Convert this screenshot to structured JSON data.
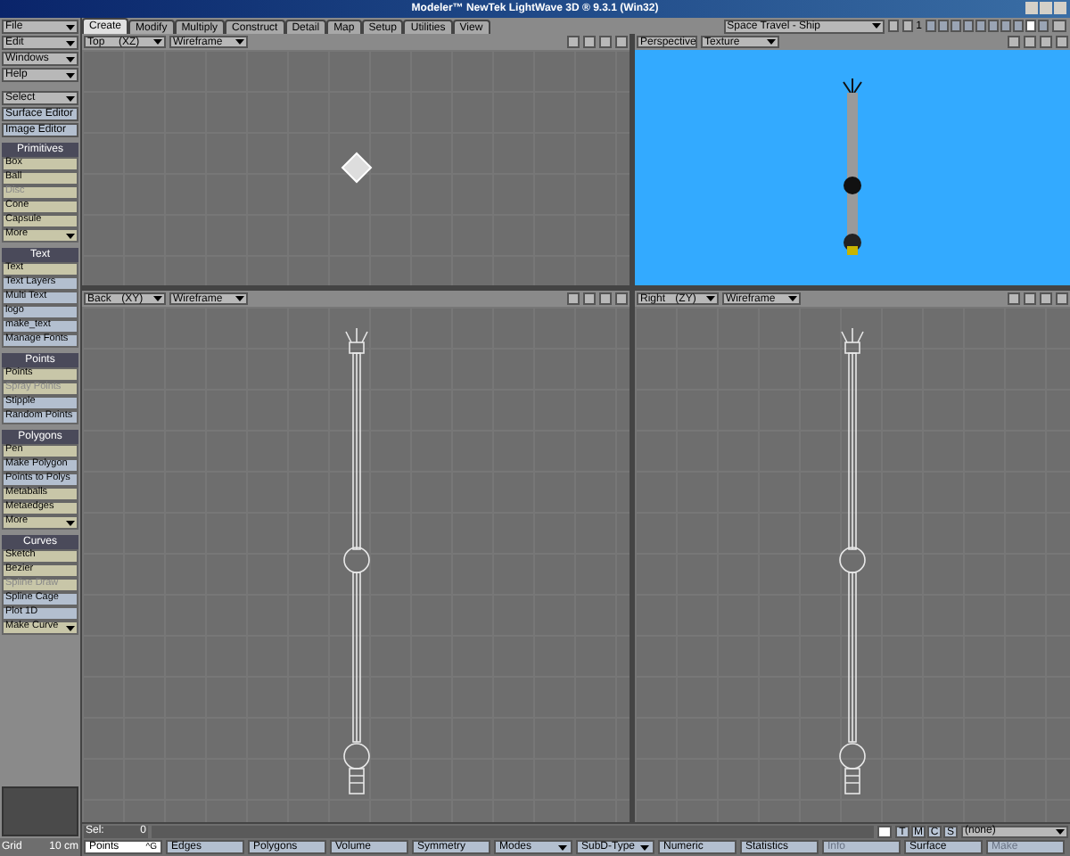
{
  "window": {
    "title": "Modeler™ NewTek LightWave 3D ® 9.3.1 (Win32)"
  },
  "menus": [
    {
      "label": "File",
      "kind": "dropdown"
    },
    {
      "label": "Edit",
      "kind": "dropdown"
    },
    {
      "label": "Windows",
      "kind": "dropdown"
    },
    {
      "label": "Help",
      "kind": "dropdown"
    },
    {
      "label": "Select",
      "kind": "dropdown"
    },
    {
      "label": "Surface Editor",
      "kind": "button"
    },
    {
      "label": "Image Editor",
      "kind": "button"
    }
  ],
  "tabs": [
    {
      "label": "Create",
      "selected": true
    },
    {
      "label": "Modify",
      "selected": false
    },
    {
      "label": "Multiply",
      "selected": false
    },
    {
      "label": "Construct",
      "selected": false
    },
    {
      "label": "Detail",
      "selected": false
    },
    {
      "label": "Map",
      "selected": false
    },
    {
      "label": "Setup",
      "selected": false
    },
    {
      "label": "Utilities",
      "selected": false
    },
    {
      "label": "View",
      "selected": false
    }
  ],
  "object": {
    "name": "Space Travel - Ship",
    "layer_number": "1"
  },
  "layers": [
    {
      "selected": false
    },
    {
      "selected": false
    },
    {
      "selected": false
    },
    {
      "selected": false
    },
    {
      "selected": false
    },
    {
      "selected": false
    },
    {
      "selected": false
    },
    {
      "selected": false
    },
    {
      "selected": true
    },
    {
      "selected": false
    }
  ],
  "sections": [
    {
      "title": "Primitives",
      "items": [
        {
          "label": "Box",
          "color": "#c8c6a8",
          "disabled": false,
          "dropdown": false
        },
        {
          "label": "Ball",
          "color": "#c8c6a8",
          "disabled": false,
          "dropdown": false
        },
        {
          "label": "Disc",
          "color": "#c8c6a8",
          "disabled": true,
          "dropdown": false
        },
        {
          "label": "Cone",
          "color": "#c8c6a8",
          "disabled": false,
          "dropdown": false
        },
        {
          "label": "Capsule",
          "color": "#c8c6a8",
          "disabled": false,
          "dropdown": false
        },
        {
          "label": "More",
          "color": "#c8c6a8",
          "disabled": false,
          "dropdown": true
        }
      ]
    },
    {
      "title": "Text",
      "items": [
        {
          "label": "Text",
          "color": "#c8c6a8",
          "disabled": false,
          "dropdown": false
        },
        {
          "label": "Text Layers",
          "color": "#b3bfcf",
          "disabled": false,
          "dropdown": false
        },
        {
          "label": "Multi Text",
          "color": "#b3bfcf",
          "disabled": false,
          "dropdown": false
        },
        {
          "label": "logo",
          "color": "#b3bfcf",
          "disabled": false,
          "dropdown": false
        },
        {
          "label": "make_text",
          "color": "#b3bfcf",
          "disabled": false,
          "dropdown": false
        },
        {
          "label": "Manage Fonts",
          "color": "#b3bfcf",
          "disabled": false,
          "dropdown": false
        }
      ]
    },
    {
      "title": "Points",
      "items": [
        {
          "label": "Points",
          "color": "#c8c6a8",
          "disabled": false,
          "dropdown": false
        },
        {
          "label": "Spray Points",
          "color": "#c8c6a8",
          "disabled": true,
          "dropdown": false
        },
        {
          "label": "Stipple",
          "color": "#b3bfcf",
          "disabled": false,
          "dropdown": false
        },
        {
          "label": "Random Points",
          "color": "#b3bfcf",
          "disabled": false,
          "dropdown": false
        }
      ]
    },
    {
      "title": "Polygons",
      "items": [
        {
          "label": "Pen",
          "color": "#c8c6a8",
          "disabled": false,
          "dropdown": false
        },
        {
          "label": "Make Polygon",
          "color": "#b3bfcf",
          "disabled": false,
          "dropdown": false
        },
        {
          "label": "Points to Polys",
          "color": "#b3bfcf",
          "disabled": false,
          "dropdown": false
        },
        {
          "label": "Metaballs",
          "color": "#c8c6a8",
          "disabled": false,
          "dropdown": false
        },
        {
          "label": "Metaedges",
          "color": "#c8c6a8",
          "disabled": false,
          "dropdown": false
        },
        {
          "label": "More",
          "color": "#c8c6a8",
          "disabled": false,
          "dropdown": true
        }
      ]
    },
    {
      "title": "Curves",
      "items": [
        {
          "label": "Sketch",
          "color": "#c8c6a8",
          "disabled": false,
          "dropdown": false
        },
        {
          "label": "Bezier",
          "color": "#c8c6a8",
          "disabled": false,
          "dropdown": false
        },
        {
          "label": "Spline Draw",
          "color": "#c8c6a8",
          "disabled": true,
          "dropdown": false
        },
        {
          "label": "Spline Cage",
          "color": "#b3bfcf",
          "disabled": false,
          "dropdown": false
        },
        {
          "label": "Plot 1D",
          "color": "#b3bfcf",
          "disabled": false,
          "dropdown": false
        },
        {
          "label": "Make Curve",
          "color": "#c8c6a8",
          "disabled": false,
          "dropdown": true
        }
      ]
    }
  ],
  "viewports": [
    {
      "view": "Top",
      "axes": "(XZ)",
      "shading": "Wireframe",
      "kind": "grid"
    },
    {
      "view": "Perspective",
      "shading": "Texture",
      "kind": "perspective"
    },
    {
      "view": "Back",
      "axes": "(XY)",
      "shading": "Wireframe",
      "kind": "grid"
    },
    {
      "view": "Right",
      "axes": "(ZY)",
      "shading": "Wireframe",
      "kind": "grid"
    }
  ],
  "status": {
    "sel_label": "Sel:",
    "sel_count": "0",
    "grid_label": "Grid",
    "grid_value": "10 cm",
    "toggles": [
      "T",
      "M",
      "C",
      "S"
    ],
    "surface": "(none)"
  },
  "bottom_buttons": [
    {
      "label": "Points",
      "shortcut": "^G",
      "selected": true,
      "disabled": false,
      "dropdown": false
    },
    {
      "label": "Edges",
      "selected": false,
      "disabled": false,
      "dropdown": false
    },
    {
      "label": "Polygons",
      "selected": false,
      "disabled": false,
      "dropdown": false
    },
    {
      "label": "Volume",
      "selected": false,
      "disabled": false,
      "dropdown": false
    },
    {
      "label": "Symmetry",
      "selected": false,
      "disabled": false,
      "dropdown": false
    },
    {
      "label": "Modes",
      "selected": false,
      "disabled": false,
      "dropdown": true
    },
    {
      "label": "SubD-Type",
      "selected": false,
      "disabled": false,
      "dropdown": true
    },
    {
      "label": "Numeric",
      "selected": false,
      "disabled": false,
      "dropdown": false
    },
    {
      "label": "Statistics",
      "selected": false,
      "disabled": false,
      "dropdown": false
    },
    {
      "label": "Info",
      "selected": false,
      "disabled": true,
      "dropdown": false
    },
    {
      "label": "Surface",
      "selected": false,
      "disabled": false,
      "dropdown": false
    },
    {
      "label": "Make",
      "selected": false,
      "disabled": true,
      "dropdown": false
    }
  ]
}
